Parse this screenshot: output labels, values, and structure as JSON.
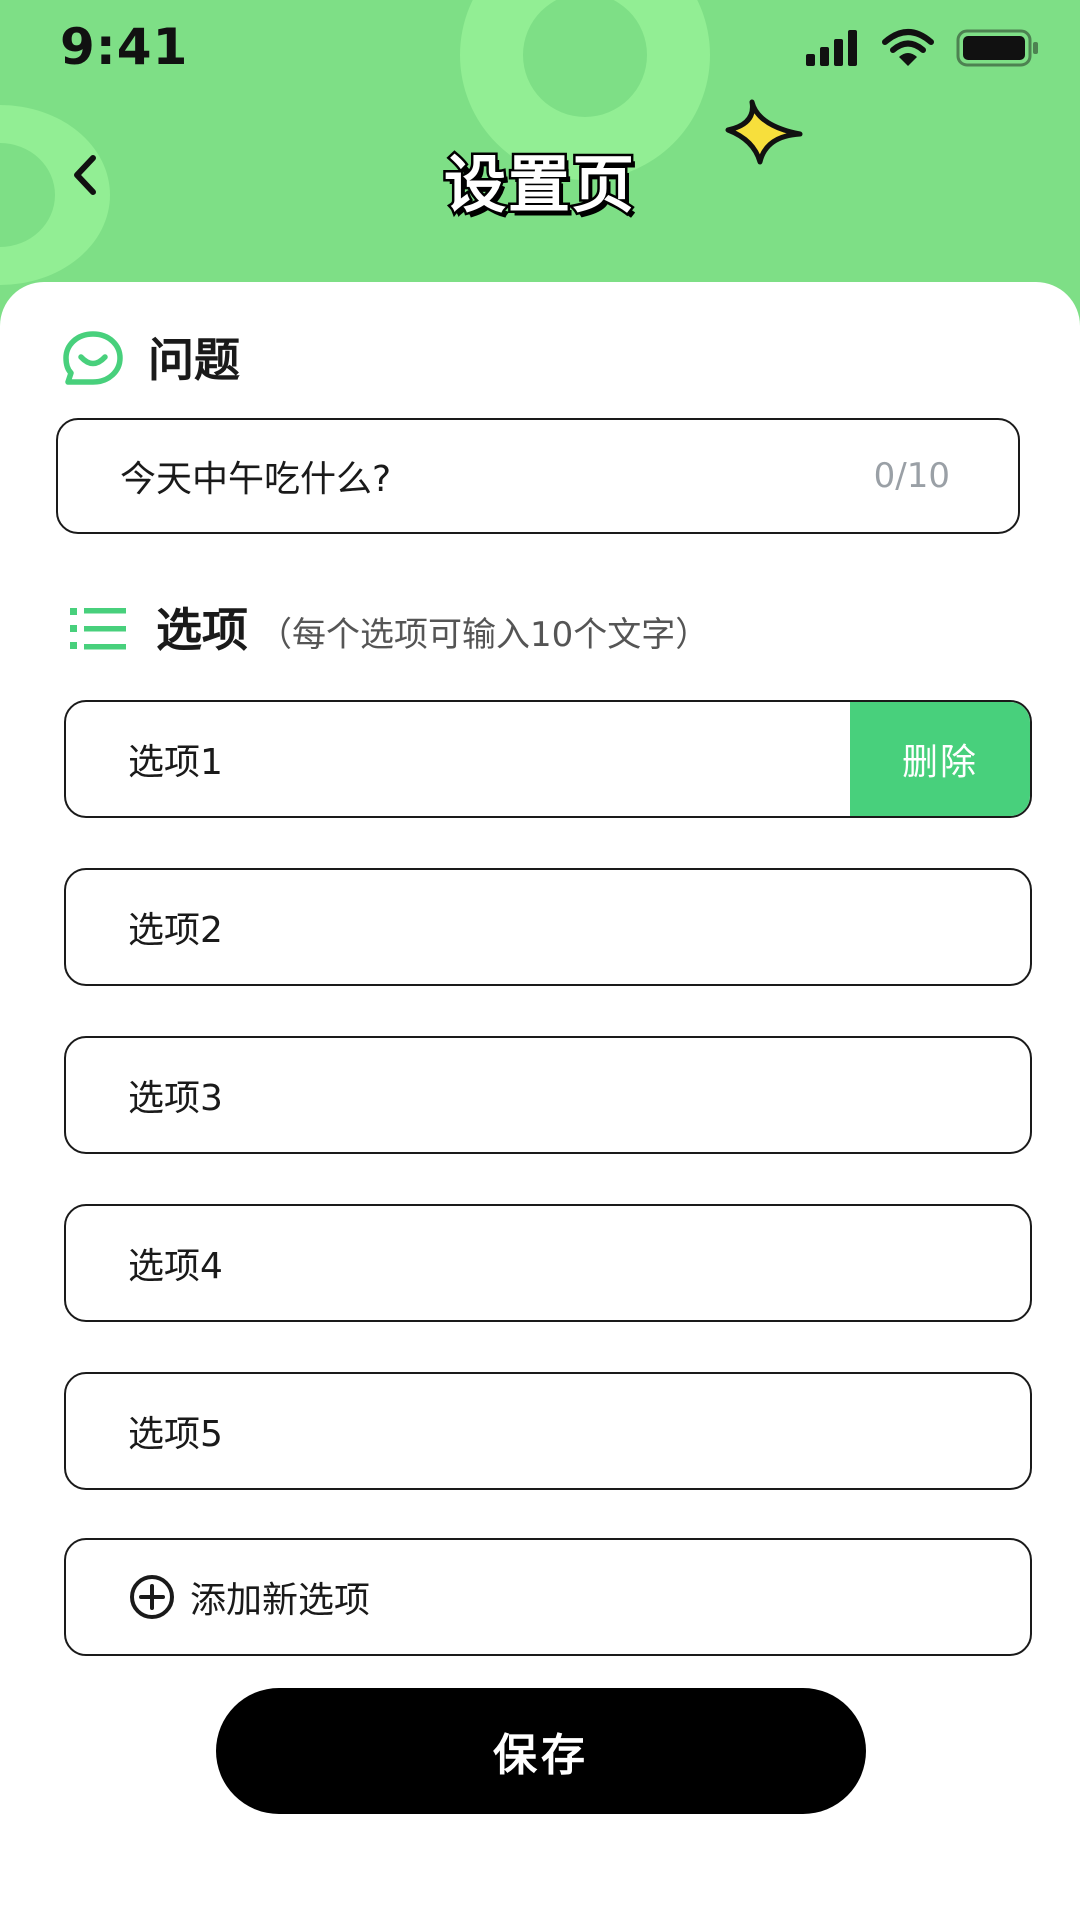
{
  "status_bar": {
    "time": "9:41",
    "icons": [
      "signal-icon",
      "wifi-icon",
      "battery-icon"
    ]
  },
  "header": {
    "title": "设置页",
    "back_icon": "chevron-left-icon",
    "decoration_icon": "sparkle-icon"
  },
  "question": {
    "section_title": "问题",
    "icon": "chat-bubble-smile-icon",
    "value": "今天中午吃什么?",
    "counter": "0/10"
  },
  "options": {
    "section_title": "选项",
    "hint": "（每个选项可输入10个文字）",
    "icon": "list-icon",
    "items": [
      {
        "label": "选项1",
        "action": "删除"
      },
      {
        "label": "选项2"
      },
      {
        "label": "选项3"
      },
      {
        "label": "选项4"
      },
      {
        "label": "选项5"
      }
    ],
    "add_label": "添加新选项",
    "add_icon": "plus-circle-icon"
  },
  "save_label": "保存",
  "colors": {
    "header_bg": "#7edf86",
    "accent_green": "#48d07c",
    "sparkle": "#f7df3c",
    "text": "#1a1a1a",
    "counter": "#9aa0a6",
    "button_bg": "#000000"
  }
}
